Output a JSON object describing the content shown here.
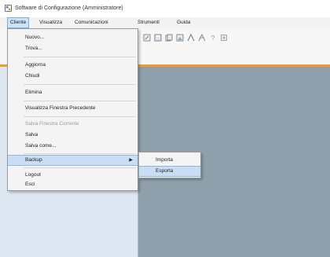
{
  "window": {
    "title": "Software di Configurazione (Amministratore)"
  },
  "menubar": {
    "items": [
      {
        "label": "Cliente"
      },
      {
        "label": "Visualizza"
      },
      {
        "label": "Comunicazioni"
      },
      {
        "label": "Strumenti"
      },
      {
        "label": "Guida"
      }
    ]
  },
  "menu": {
    "items": [
      {
        "label": "Nuovo..."
      },
      {
        "label": "Trova..."
      },
      {
        "label": "Aggiorna"
      },
      {
        "label": "Chiudi"
      },
      {
        "label": "Elimina"
      },
      {
        "label": "Visualizza Finestra Precedente"
      },
      {
        "label": "Salva Finestra Corrente"
      },
      {
        "label": "Salva"
      },
      {
        "label": "Salva come..."
      },
      {
        "label": "Backup",
        "submenu_arrow": "▶"
      },
      {
        "label": "Logout"
      },
      {
        "label": "Esci"
      }
    ]
  },
  "submenu": {
    "items": [
      {
        "label": "Importa"
      },
      {
        "label": "Esporta"
      }
    ]
  },
  "colors": {
    "accent_line": "#f29a2e",
    "left_panel": "#dde7f1",
    "work_area": "#8fa0ad",
    "highlight": "#c9def4"
  }
}
